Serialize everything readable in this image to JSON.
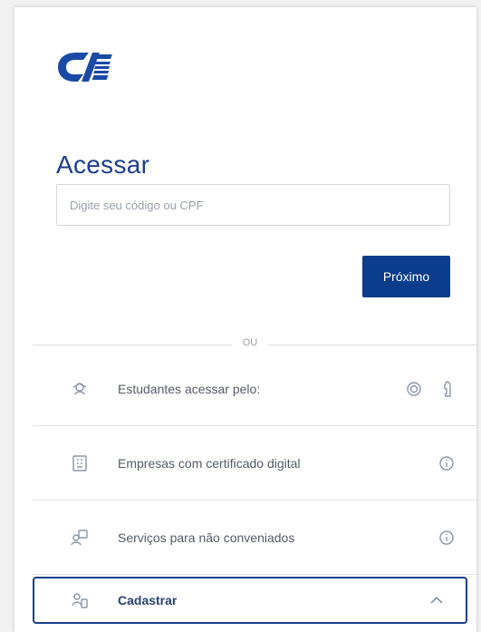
{
  "brand": {
    "logo_text": "CIEE",
    "primary_color": "#0b3d8c",
    "title_color": "#1b3e8f"
  },
  "login": {
    "title": "Acessar",
    "input_placeholder": "Digite seu código ou CPF",
    "next_label": "Próximo"
  },
  "divider": {
    "label": "OU"
  },
  "options": [
    {
      "label": "Estudantes acessar pelo:",
      "icon": "student-icon",
      "trailing_icons": [
        "globe-icon",
        "thumb-icon"
      ]
    },
    {
      "label": "Empresas com certificado digital",
      "icon": "building-icon",
      "trailing_icons": [
        "info-icon"
      ]
    },
    {
      "label": "Serviços para não conveniados",
      "icon": "services-icon",
      "trailing_icons": [
        "info-icon"
      ]
    },
    {
      "label": "Cadastrar",
      "icon": "register-icon",
      "trailing_icons": [
        "chevron-up-icon"
      ],
      "active": true
    }
  ]
}
